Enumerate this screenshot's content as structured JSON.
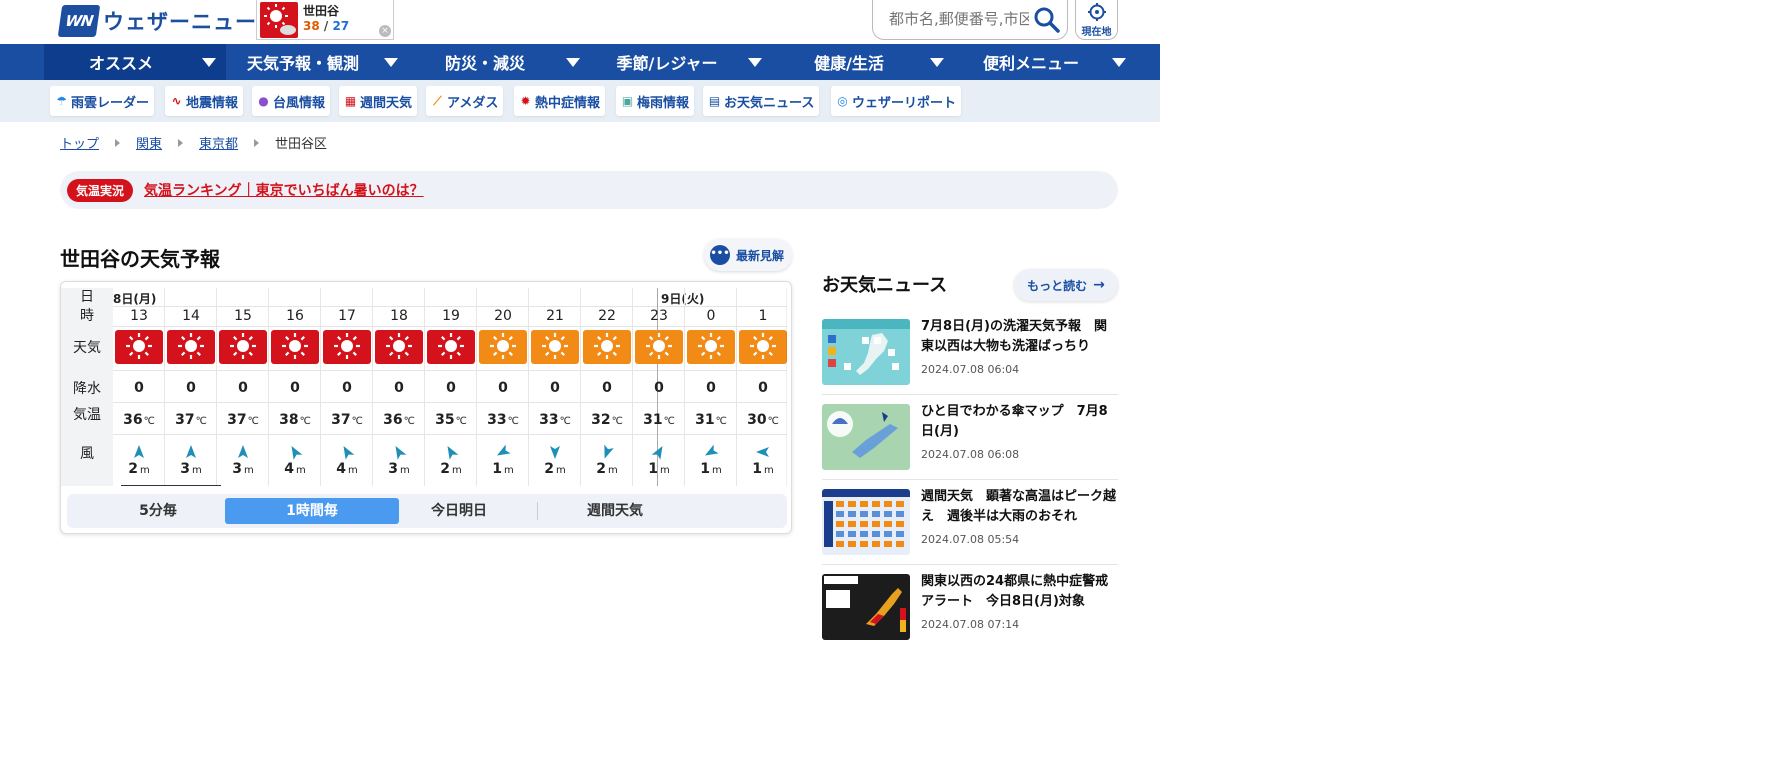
{
  "brand": {
    "name": "ウェザーニュース",
    "mark": "WN"
  },
  "mini_weather": {
    "city": "世田谷",
    "max": "38",
    "min": "27",
    "sep": " / "
  },
  "search": {
    "placeholder": "都市名,郵便番号,市区町村",
    "location_label": "現在地"
  },
  "nav": [
    {
      "label": "オススメ"
    },
    {
      "label": "天気予報・観測"
    },
    {
      "label": "防災・減災"
    },
    {
      "label": "季節/レジャー"
    },
    {
      "label": "健康/生活"
    },
    {
      "label": "便利メニュー"
    }
  ],
  "subnav": [
    {
      "label": "雨雲レーダー",
      "icon": "cloud-rain-icon"
    },
    {
      "label": "地震情報",
      "icon": "seismic-wave-icon"
    },
    {
      "label": "台風情報",
      "icon": "typhoon-icon"
    },
    {
      "label": "週間天気",
      "icon": "calendar-icon"
    },
    {
      "label": "アメダス",
      "icon": "line-chart-icon"
    },
    {
      "label": "熱中症情報",
      "icon": "heat-icon"
    },
    {
      "label": "梅雨情報",
      "icon": "rainy-season-icon"
    },
    {
      "label": "お天気ニュース",
      "icon": "news-icon"
    },
    {
      "label": "ウェザーリポート",
      "icon": "report-icon"
    }
  ],
  "breadcrumb": [
    {
      "label": "トップ"
    },
    {
      "label": "関東"
    },
    {
      "label": "東京都"
    }
  ],
  "breadcrumb_current": "世田谷区",
  "alert": {
    "badge": "気温実況",
    "link": "気温ランキング｜東京でいちばん暑いのは？"
  },
  "forecast": {
    "title": "世田谷の天気予報",
    "latest_button": "最新見解",
    "row_labels": {
      "day": "日",
      "hour": "時",
      "weather": "天気",
      "rain": "降水",
      "temp": "気温",
      "wind": "風"
    },
    "days": [
      "8日(月)",
      "9日(火)"
    ],
    "hours": [
      "13",
      "14",
      "15",
      "16",
      "17",
      "18",
      "19",
      "20",
      "21",
      "22",
      "23",
      "0",
      "1"
    ],
    "weather": [
      "hot",
      "hot",
      "hot",
      "hot",
      "hot",
      "hot",
      "hot",
      "sunny",
      "sunny",
      "sunny",
      "sunny",
      "sunny",
      "sunny"
    ],
    "rain": [
      "0",
      "0",
      "0",
      "0",
      "0",
      "0",
      "0",
      "0",
      "0",
      "0",
      "0",
      "0",
      "0"
    ],
    "temp": [
      "36",
      "37",
      "37",
      "38",
      "37",
      "36",
      "35",
      "33",
      "33",
      "32",
      "31",
      "31",
      "30"
    ],
    "temp_unit": "℃",
    "wind_speed": [
      "2",
      "3",
      "3",
      "4",
      "4",
      "3",
      "2",
      "1",
      "2",
      "2",
      "1",
      "1",
      "1"
    ],
    "wind_unit": "m",
    "wind_dir_deg": [
      0,
      0,
      0,
      330,
      330,
      330,
      330,
      240,
      180,
      200,
      30,
      240,
      270
    ],
    "colors": {
      "hot": "#d4121b",
      "sunny": "#f28a16",
      "wind_arrow": "#1f8fb8"
    },
    "tabs": [
      "5分毎",
      "1時間毎",
      "今日明日",
      "週間天気"
    ],
    "active_tab": "1時間毎"
  },
  "news": {
    "title": "お天気ニュース",
    "more": "もっと読む",
    "items": [
      {
        "headline": "7月8日(月)の洗濯天気予報　関東以西は大物も洗濯ばっちり",
        "date": "2024.07.08 06:04"
      },
      {
        "headline": "ひと目でわかる傘マップ　7月8日(月)",
        "date": "2024.07.08 06:08"
      },
      {
        "headline": "週間天気　顕著な高温はピーク越え　週後半は大雨のおそれ",
        "date": "2024.07.08 05:54"
      },
      {
        "headline": "関東以西の24都県に熱中症警戒アラート　今日8日(月)対象",
        "date": "2024.07.08 07:14"
      }
    ]
  }
}
